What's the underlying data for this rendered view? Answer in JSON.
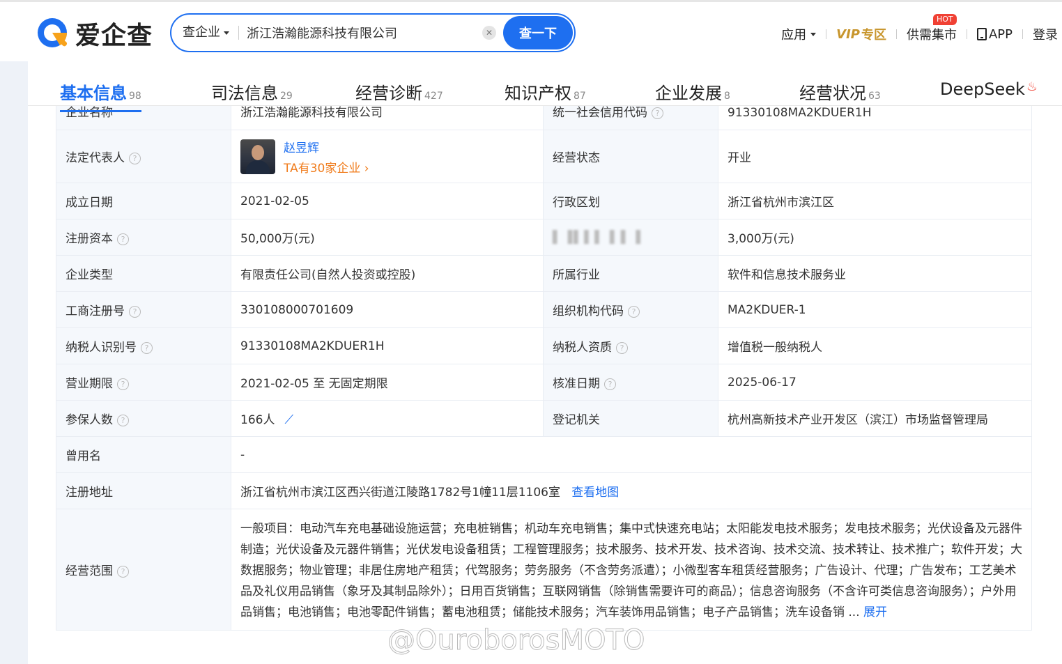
{
  "header": {
    "logo_text": "爱企查",
    "search": {
      "type_label": "查企业",
      "value": "浙江浩瀚能源科技有限公司",
      "button_label": "查一下"
    },
    "nav": {
      "apps": "应用",
      "vip": "VIP",
      "vip_zone": "专区",
      "market": "供需集市",
      "hot_badge": "HOT",
      "app": "APP",
      "login": "登录"
    }
  },
  "tabs": [
    {
      "label": "基本信息",
      "count": "98"
    },
    {
      "label": "司法信息",
      "count": "29"
    },
    {
      "label": "经营诊断",
      "count": "427"
    },
    {
      "label": "知识产权",
      "count": "87"
    },
    {
      "label": "企业发展",
      "count": "8"
    },
    {
      "label": "经营状况",
      "count": "63"
    },
    {
      "label": "DeepSeek",
      "count": ""
    }
  ],
  "info": {
    "company_name_label": "企业名称",
    "company_name": "浙江浩瀚能源科技有限公司",
    "credit_code_label": "统一社会信用代码",
    "credit_code": "91330108MA2KDUER1H",
    "legal_rep_label": "法定代表人",
    "legal_rep_name": "赵昱辉",
    "legal_rep_companies": "TA有30家企业",
    "status_label": "经营状态",
    "status": "开业",
    "founded_label": "成立日期",
    "founded": "2021-02-05",
    "region_label": "行政区划",
    "region": "浙江省杭州市滨江区",
    "reg_capital_label": "注册资本",
    "reg_capital": "50,000万(元)",
    "paid_capital_label": "▌▐▌▌▌▐ ▌▐",
    "paid_capital": "3,000万(元)",
    "type_label": "企业类型",
    "type": "有限责任公司(自然人投资或控股)",
    "industry_label": "所属行业",
    "industry": "软件和信息技术服务业",
    "reg_no_label": "工商注册号",
    "reg_no": "330108000701609",
    "org_code_label": "组织机构代码",
    "org_code": "MA2KDUER-1",
    "tax_id_label": "纳税人识别号",
    "tax_id": "91330108MA2KDUER1H",
    "tax_qual_label": "纳税人资质",
    "tax_qual": "增值税一般纳税人",
    "term_label": "营业期限",
    "term": "2021-02-05 至 无固定期限",
    "approved_label": "核准日期",
    "approved": "2025-06-17",
    "insured_label": "参保人数",
    "insured": "166人",
    "authority_label": "登记机关",
    "authority": "杭州高新技术产业开发区（滨江）市场监督管理局",
    "former_name_label": "曾用名",
    "former_name": "-",
    "address_label": "注册地址",
    "address": "浙江省杭州市滨江区西兴街道江陵路1782号1幢11层1106室",
    "map_link": "查看地图",
    "scope_label": "经营范围",
    "scope": "一般项目：电动汽车充电基础设施运营；充电桩销售；机动车充电销售；集中式快速充电站；太阳能发电技术服务；发电技术服务；光伏设备及元器件制造；光伏设备及元器件销售；光伏发电设备租赁；工程管理服务；技术服务、技术开发、技术咨询、技术交流、技术转让、技术推广；软件开发；大数据服务；物业管理；非居住房地产租赁；代驾服务；劳务服务（不含劳务派遣）；小微型客车租赁经营服务；广告设计、代理；广告发布；工艺美术品及礼仪用品销售（象牙及其制品除外）；日用百货销售；互联网销售（除销售需要许可的商品）；信息咨询服务（不含许可类信息咨询服务）；户外用品销售；电池销售；电池零配件销售；蓄电池租赁；储能技术服务；汽车装饰用品销售；电子产品销售；洗车设备销",
    "scope_ellipsis": "...",
    "expand_label": "展开"
  },
  "watermark": "@OuroborosMOTO",
  "colors": {
    "accent": "#1e6ff0",
    "orange": "#f07c1c",
    "vip_gold": "#c8962e",
    "hot_red": "#f04134"
  }
}
